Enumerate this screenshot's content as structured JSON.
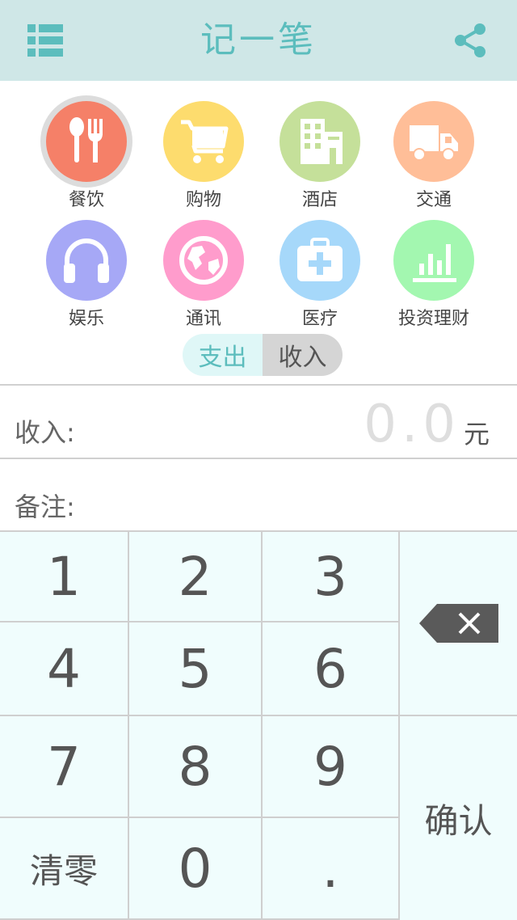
{
  "header": {
    "title": "记一笔",
    "menu_icon": "list-menu-icon",
    "share_icon": "share-icon",
    "background": "#cfe7e7",
    "accent": "#5cbdbd"
  },
  "categories": [
    {
      "label": "餐饮",
      "icon": "fork-spoon-icon",
      "color": "#f58068",
      "selected": true
    },
    {
      "label": "购物",
      "icon": "shopping-cart-icon",
      "color": "#fddc6e"
    },
    {
      "label": "酒店",
      "icon": "hotel-building-icon",
      "color": "#c5e09a"
    },
    {
      "label": "交通",
      "icon": "truck-icon",
      "color": "#ffbe98"
    },
    {
      "label": "娱乐",
      "icon": "headphones-icon",
      "color": "#a6a8f6"
    },
    {
      "label": "通讯",
      "icon": "globe-icon",
      "color": "#ff9ccc"
    },
    {
      "label": "医疗",
      "icon": "medical-kit-icon",
      "color": "#a6d8fa"
    },
    {
      "label": "投资理财",
      "icon": "bar-chart-icon",
      "color": "#a3f7b0"
    }
  ],
  "toggle": {
    "expense": "支出",
    "income": "收入",
    "active": "收入"
  },
  "amount": {
    "label": "收入:",
    "value": "0.0",
    "unit": "元"
  },
  "note": {
    "label": "备注:"
  },
  "keypad": {
    "k1": "1",
    "k2": "2",
    "k3": "3",
    "k4": "4",
    "k5": "5",
    "k6": "6",
    "k7": "7",
    "k8": "8",
    "k9": "9",
    "clear": "清零",
    "k0": "0",
    "dot": ".",
    "confirm": "确认",
    "delete_icon": "backspace-icon"
  }
}
